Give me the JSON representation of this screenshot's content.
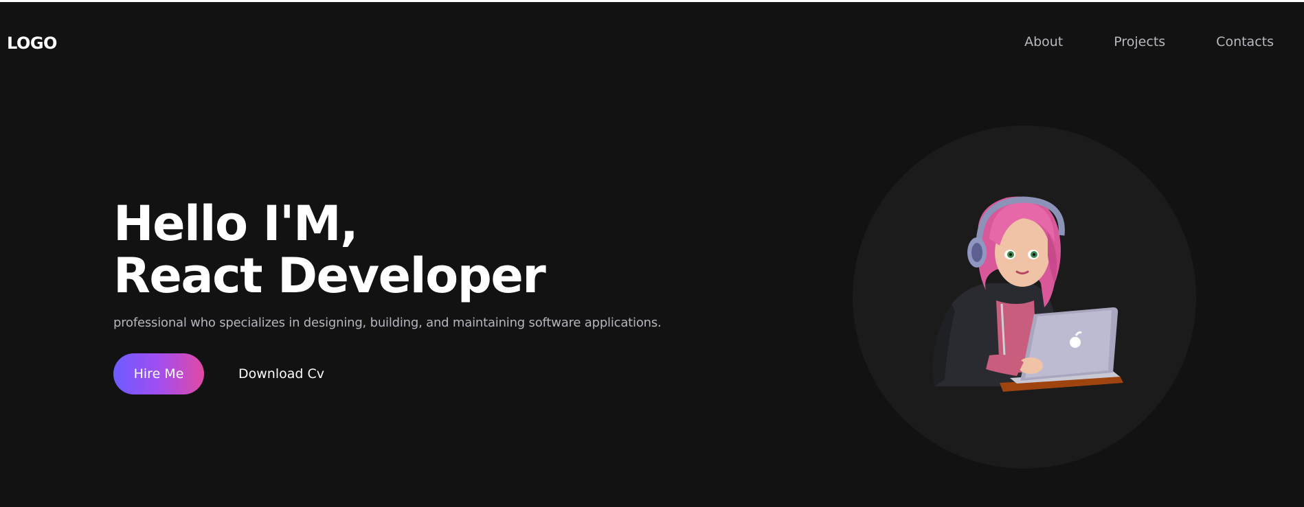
{
  "header": {
    "logo": "LOGO",
    "nav": [
      {
        "label": "About"
      },
      {
        "label": "Projects"
      },
      {
        "label": "Contacts"
      }
    ]
  },
  "hero": {
    "title_line1": "Hello I'M,",
    "title_line2": "React Developer",
    "subtitle": "professional who specializes in designing, building, and maintaining software applications.",
    "hire_label": "Hire Me",
    "download_label": "Download Cv"
  },
  "colors": {
    "background": "#121212",
    "accent_start": "#6d5cff",
    "accent_end": "#e04aa3",
    "nav_text": "#b9b9c2"
  },
  "illustration": {
    "icon": "developer-girl-avatar"
  }
}
